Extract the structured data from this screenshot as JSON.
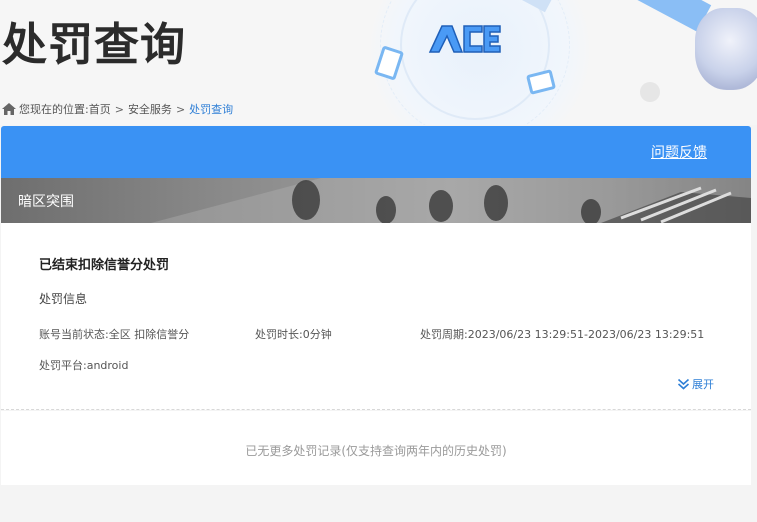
{
  "header": {
    "title": "处罚查询",
    "logo_text": "ACE"
  },
  "breadcrumb": {
    "prefix": "您现在的位置:",
    "items": [
      "首页",
      "安全服务"
    ],
    "separator": ">",
    "current": "处罚查询"
  },
  "toolbar": {
    "feedback_label": "问题反馈"
  },
  "banner": {
    "game_name": "暗区突围"
  },
  "record": {
    "status_title": "已结束扣除信誉分处罚",
    "section_label": "处罚信息",
    "account_status": "账号当前状态:全区 扣除信誉分",
    "duration": "处罚时长:0分钟",
    "period": "处罚周期:2023/06/23 13:29:51-2023/06/23 13:29:51",
    "platform": "处罚平台:android",
    "expand_label": "展开"
  },
  "footer": {
    "note": "已无更多处罚记录(仅支持查询两年内的历史处罚)"
  },
  "colors": {
    "accent": "#3a92f4",
    "link": "#2f7fd6"
  },
  "icons": [
    "home-icon",
    "ace-logo",
    "expand-chevron-icon"
  ]
}
